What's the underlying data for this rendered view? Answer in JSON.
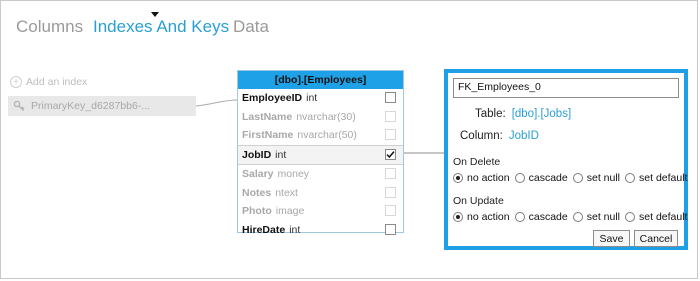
{
  "tabs": [
    {
      "label": "Columns",
      "state": "inactive"
    },
    {
      "label": "Indexes And Keys",
      "state": "active"
    },
    {
      "label": "Data",
      "state": "inactive"
    }
  ],
  "left_panel": {
    "add_index_label": "Add an index",
    "primary_key_label": "PrimaryKey_d6287bb6-..."
  },
  "table": {
    "title": "[dbo].[Employees]",
    "columns": [
      {
        "name": "EmployeeID",
        "type": "int",
        "enabled": true,
        "checked": false
      },
      {
        "name": "LastName",
        "type": "nvarchar(30)",
        "enabled": false,
        "checked": false
      },
      {
        "name": "FirstName",
        "type": "nvarchar(50)",
        "enabled": false,
        "checked": false
      },
      {
        "name": "JobID",
        "type": "int",
        "enabled": true,
        "checked": true
      },
      {
        "name": "Salary",
        "type": "money",
        "enabled": false,
        "checked": false
      },
      {
        "name": "Notes",
        "type": "ntext",
        "enabled": false,
        "checked": false
      },
      {
        "name": "Photo",
        "type": "image",
        "enabled": false,
        "checked": false
      },
      {
        "name": "HireDate",
        "type": "int",
        "enabled": true,
        "checked": false
      }
    ]
  },
  "fk_panel": {
    "name_value": "FK_Employees_0",
    "table_label": "Table:",
    "table_value": "[dbo].[Jobs]",
    "column_label": "Column:",
    "column_value": "JobID",
    "on_delete_label": "On Delete",
    "on_update_label": "On Update",
    "options": [
      "no action",
      "cascade",
      "set null",
      "set default"
    ],
    "on_delete_selected": "no action",
    "on_update_selected": "no action",
    "save_label": "Save",
    "cancel_label": "Cancel"
  },
  "colors": {
    "accent": "#1e9fe6",
    "tab_active": "#2a9fd6",
    "tab_inactive": "#9a9a9a"
  },
  "icons": {
    "add": "plus-circle-icon",
    "key": "key-icon",
    "check": "checkmark-icon"
  }
}
